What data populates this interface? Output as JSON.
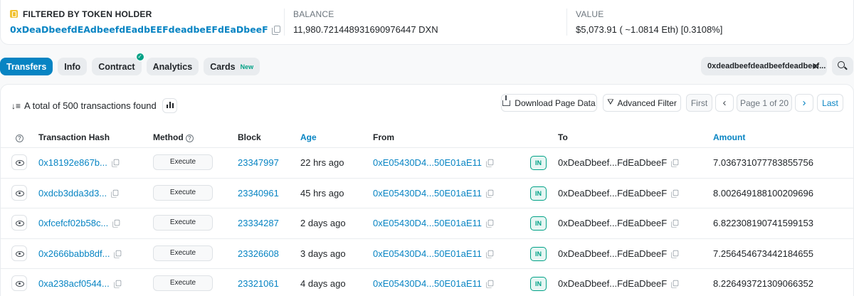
{
  "header": {
    "filter_label": "FILTERED BY TOKEN HOLDER",
    "holder_address": "0xDeaDbeefdEAdbeefdEadbEEFdeadbeEFdEaDbeeF",
    "balance_label": "BALANCE",
    "balance_value": "11,980.72144893169097644 7 DXN",
    "value_label": "VALUE",
    "value_value": "$5,073.91 ( ~1.0814 Eth) [0.3108%]"
  },
  "tabs": [
    {
      "label": "Transfers",
      "active": true
    },
    {
      "label": "Info"
    },
    {
      "label": "Contract",
      "verified": true
    },
    {
      "label": "Analytics"
    },
    {
      "label": "Cards",
      "badge": "New"
    }
  ],
  "filter_chip": {
    "text": "0xdeadbeefdeadbeefdeadbeef...",
    "close": "✕"
  },
  "summary": {
    "text": "A total of 500 transactions found"
  },
  "controls": {
    "download": "Download Page Data",
    "advanced_filter": "Advanced Filter",
    "first": "First",
    "prev": "‹",
    "page": "Page 1 of 20",
    "next": "›",
    "last": "Last"
  },
  "columns": {
    "help": "?",
    "hash": "Transaction Hash",
    "method": "Method",
    "block": "Block",
    "age": "Age",
    "from": "From",
    "to": "To",
    "amount": "Amount"
  },
  "rows": [
    {
      "hash": "0x18192e867b...",
      "method": "Execute",
      "block": "23347997",
      "age": "22 hrs ago",
      "from": "0xE05430D4...50E01aE11",
      "dir": "IN",
      "to": "0xDeaDbeef...FdEaDbeeF",
      "amount": "7.036731077783855756"
    },
    {
      "hash": "0xdcb3dda3d3...",
      "method": "Execute",
      "block": "23340961",
      "age": "45 hrs ago",
      "from": "0xE05430D4...50E01aE11",
      "dir": "IN",
      "to": "0xDeaDbeef...FdEaDbeeF",
      "amount": "8.002649188100209696"
    },
    {
      "hash": "0xfcefcf02b58c...",
      "method": "Execute",
      "block": "23334287",
      "age": "2 days ago",
      "from": "0xE05430D4...50E01aE11",
      "dir": "IN",
      "to": "0xDeaDbeef...FdEaDbeeF",
      "amount": "6.822308190741599153"
    },
    {
      "hash": "0x2666babb8df...",
      "method": "Execute",
      "block": "23326608",
      "age": "3 days ago",
      "from": "0xE05430D4...50E01aE11",
      "dir": "IN",
      "to": "0xDeaDbeef...FdEaDbeeF",
      "amount": "7.256454673442184655"
    },
    {
      "hash": "0xa238acf0544...",
      "method": "Execute",
      "block": "23321061",
      "age": "4 days ago",
      "from": "0xE05430D4...50E01aE11",
      "dir": "IN",
      "to": "0xDeaDbeef...FdEaDbeeF",
      "amount": "8.226493721309066352"
    }
  ],
  "icons": {
    "holder": "token-holder-icon",
    "copy": "copy-icon",
    "search": "search-icon",
    "eye": "eye-icon",
    "download": "download-icon",
    "filter": "filter-icon",
    "sort": "sort-icon",
    "chart": "bar-chart-icon"
  },
  "colors": {
    "accent": "#0784c3",
    "success": "#00a186",
    "border": "#e9ecef"
  }
}
